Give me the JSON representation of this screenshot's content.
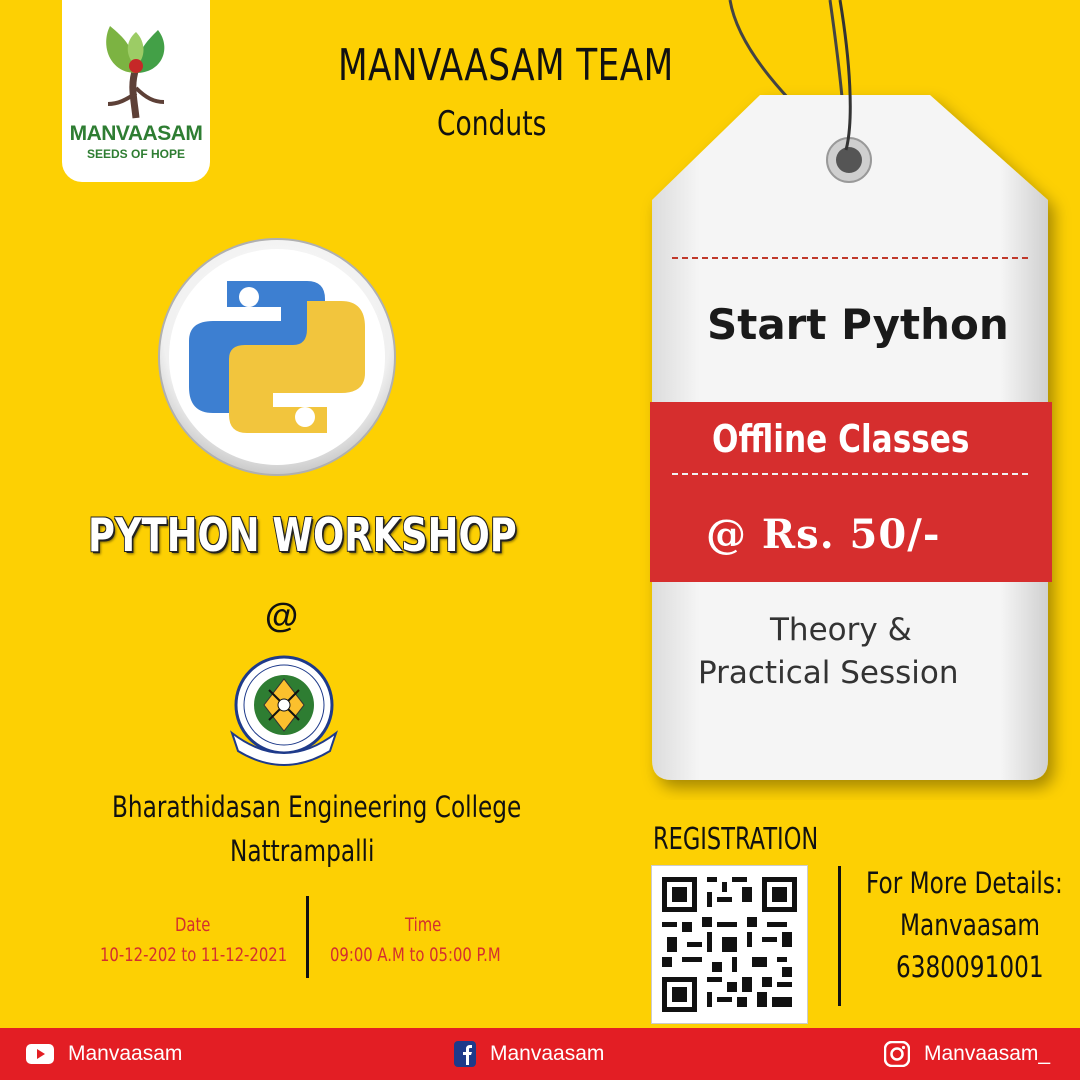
{
  "brand": {
    "logo_name": "MANVAASAM",
    "logo_tagline": "SEEDS OF HOPE"
  },
  "header": {
    "team": "MANVAASAM TEAM",
    "subtitle": "Conduts"
  },
  "workshop": {
    "title": "PYTHON WORKSHOP",
    "at": "@",
    "college_name": "Bharathidasan Engineering College",
    "college_town": "Nattrampalli"
  },
  "schedule": {
    "date_label": "Date",
    "date_value": "10-12-202 to 11-12-2021",
    "time_label": "Time",
    "time_value": "09:00 A.M to 05:00 P.M"
  },
  "price_tag": {
    "heading": "Start Python",
    "mode": "Offline Classes",
    "price": "@ Rs. 50/-",
    "session_line1": "Theory &",
    "session_line2": "Practical Session"
  },
  "registration": {
    "label": "REGISTRATION"
  },
  "contact": {
    "heading": "For More Details:",
    "name": "Manvaasam",
    "phone": "6380091001"
  },
  "footer": {
    "youtube": "Manvaasam",
    "facebook": "Manvaasam",
    "instagram": "Manvaasam_"
  },
  "colors": {
    "background": "#FDD003",
    "accent_red": "#E31E24",
    "python_blue": "#3D7FD1",
    "python_yellow": "#F2C53D",
    "brand_green": "#2E7D32"
  }
}
